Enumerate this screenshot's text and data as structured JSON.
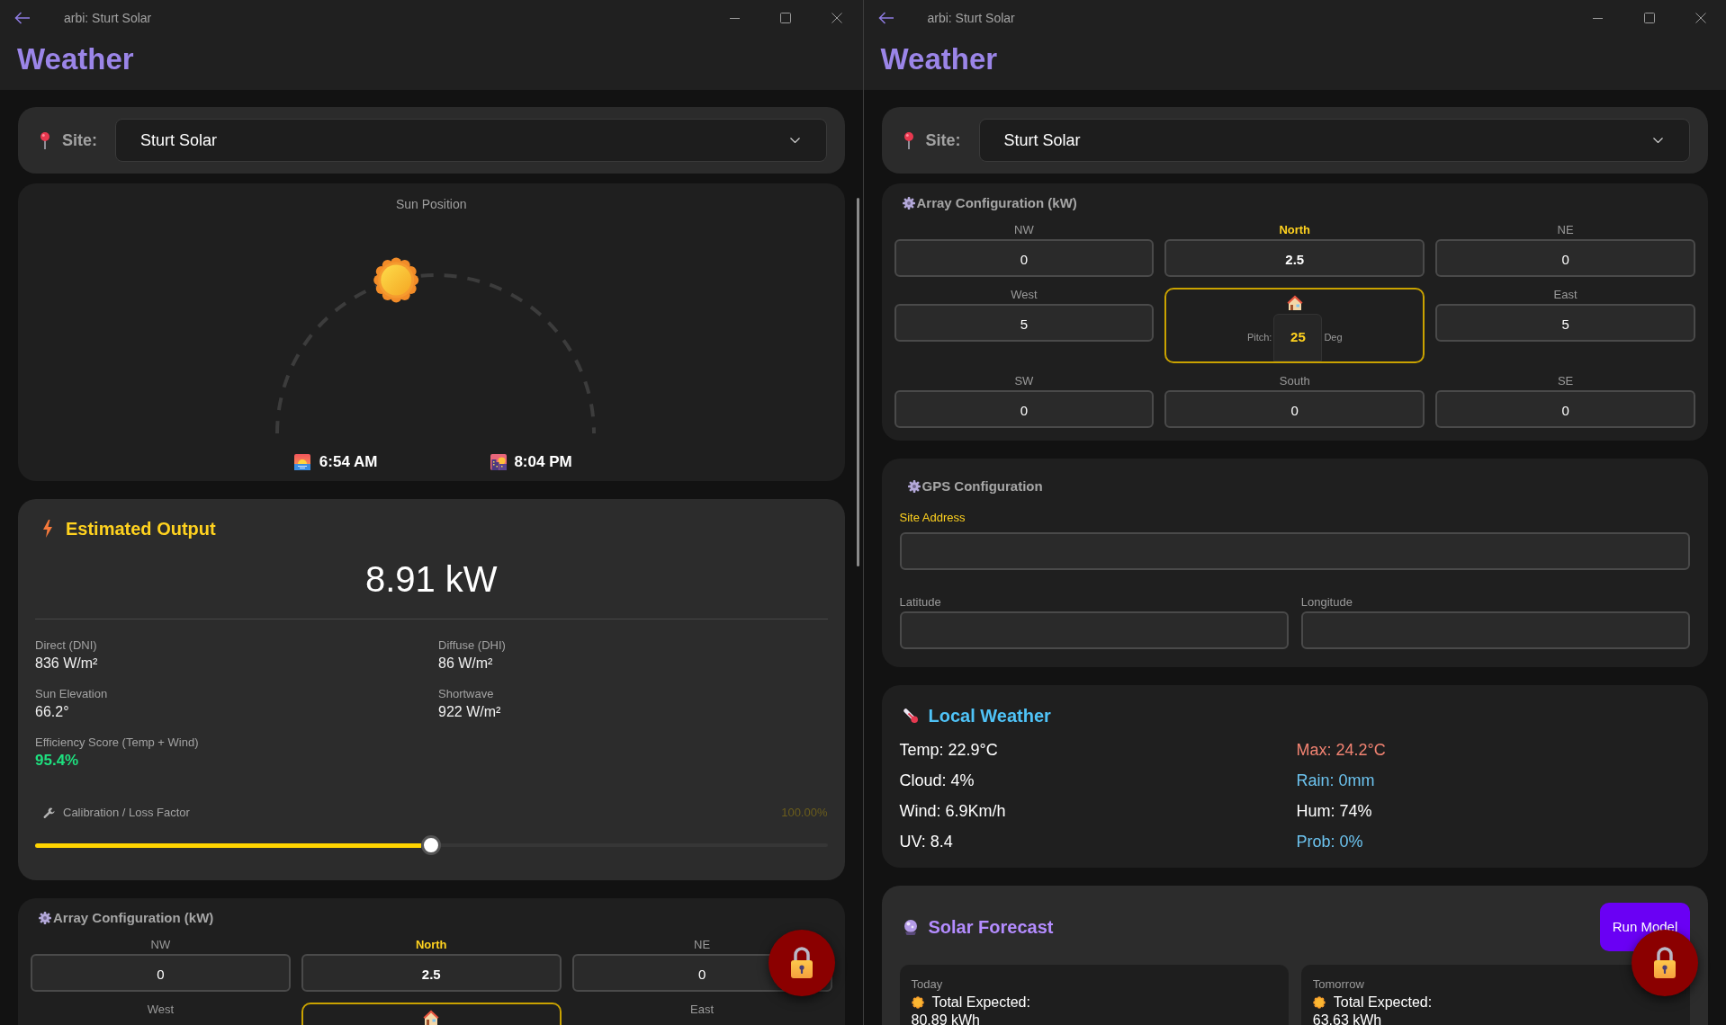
{
  "windows": [
    {
      "title": "arbi: Sturt Solar",
      "heading": "Weather",
      "scrollbar": true,
      "site": {
        "label": "Site:",
        "value": "Sturt Solar"
      },
      "sections": [
        {
          "kind": "sun_position",
          "title": "Sun Position",
          "level": 0.42,
          "sunrise": "6:54 AM",
          "sunset": "8:04 PM"
        },
        {
          "kind": "estimated_output",
          "title": "Estimated Output",
          "value": "8.91 kW",
          "stats": [
            {
              "kind": "plain",
              "label": "Direct (DNI)",
              "value": "836 W/m²"
            },
            {
              "kind": "plain",
              "label": "Diffuse (DHI)",
              "value": "86 W/m²"
            },
            {
              "kind": "plain",
              "label": "Sun Elevation",
              "value": "66.2°"
            },
            {
              "kind": "plain",
              "label": "Shortwave",
              "value": "922 W/m²"
            },
            {
              "kind": "score",
              "label": "Efficiency Score (Temp + Wind)",
              "value": "95.4%"
            }
          ],
          "calibration": {
            "label": "Calibration / Loss Factor",
            "reading": "100.00%",
            "level": 0.5
          }
        },
        {
          "kind": "array_config",
          "title": "Array Configuration (kW)",
          "cells": [
            {
              "label": "NW",
              "highlighted": false,
              "value": "0"
            },
            {
              "label": "North",
              "highlighted": true,
              "value": "2.5"
            },
            {
              "label": "NE",
              "highlighted": false,
              "value": "0"
            },
            {
              "label": "West",
              "highlighted": false
            },
            {
              "label": "East",
              "highlighted": false
            }
          ]
        }
      ]
    },
    {
      "title": "arbi: Sturt Solar",
      "heading": "Weather",
      "scrollbar": false,
      "site": {
        "label": "Site:",
        "value": "Sturt Solar"
      },
      "sections": [
        {
          "kind": "array_config",
          "title": "Array Configuration (kW)",
          "cells": [
            {
              "label": "NW",
              "highlighted": false,
              "value": "0"
            },
            {
              "label": "North",
              "highlighted": true,
              "value": "2.5"
            },
            {
              "label": "NE",
              "highlighted": false,
              "value": "0"
            },
            {
              "label": "West",
              "highlighted": false,
              "value": "5"
            },
            {
              "label": "East",
              "highlighted": false,
              "value": "5"
            },
            {
              "label": "SW",
              "highlighted": false,
              "value": "0"
            },
            {
              "label": "South",
              "highlighted": false,
              "value": "0"
            },
            {
              "label": "SE",
              "highlighted": false,
              "value": "0"
            }
          ],
          "pitch": {
            "label": "Pitch:",
            "value": "25",
            "unit": "Deg"
          }
        },
        {
          "kind": "gps_config",
          "title": "GPS Configuration",
          "fields": [
            {
              "kind": "wide",
              "label": "Site Address",
              "highlighted": true
            },
            {
              "kind": "half",
              "label": "Latitude",
              "highlighted": false
            },
            {
              "kind": "half",
              "label": "Longitude",
              "highlighted": false
            }
          ]
        },
        {
          "kind": "local_weather",
          "title": "Local Weather",
          "readings": [
            {
              "text": "Temp: 22.9°C",
              "color": "#ffffff"
            },
            {
              "text": "Max: 24.2°C",
              "color": "#f28372"
            },
            {
              "text": "Cloud: 4%",
              "color": "#ffffff"
            },
            {
              "text": "Rain: 0mm",
              "color": "#6cc3ef"
            },
            {
              "text": "Wind: 6.9Km/h",
              "color": "#ffffff"
            },
            {
              "text": "Hum: 74%",
              "color": "#ffffff"
            },
            {
              "text": "UV: 8.4",
              "color": "#ffffff"
            },
            {
              "text": "Prob: 0%",
              "color": "#6cc3ef"
            }
          ]
        },
        {
          "kind": "solar_forecast",
          "title": "Solar Forecast",
          "button": "Run Model",
          "days": [
            {
              "label": "Today",
              "total_label": "Total Expected:",
              "total": "80.89 kWh"
            },
            {
              "label": "Tomorrow",
              "total_label": "Total Expected:",
              "total": "63.63 kWh"
            }
          ]
        }
      ]
    }
  ]
}
